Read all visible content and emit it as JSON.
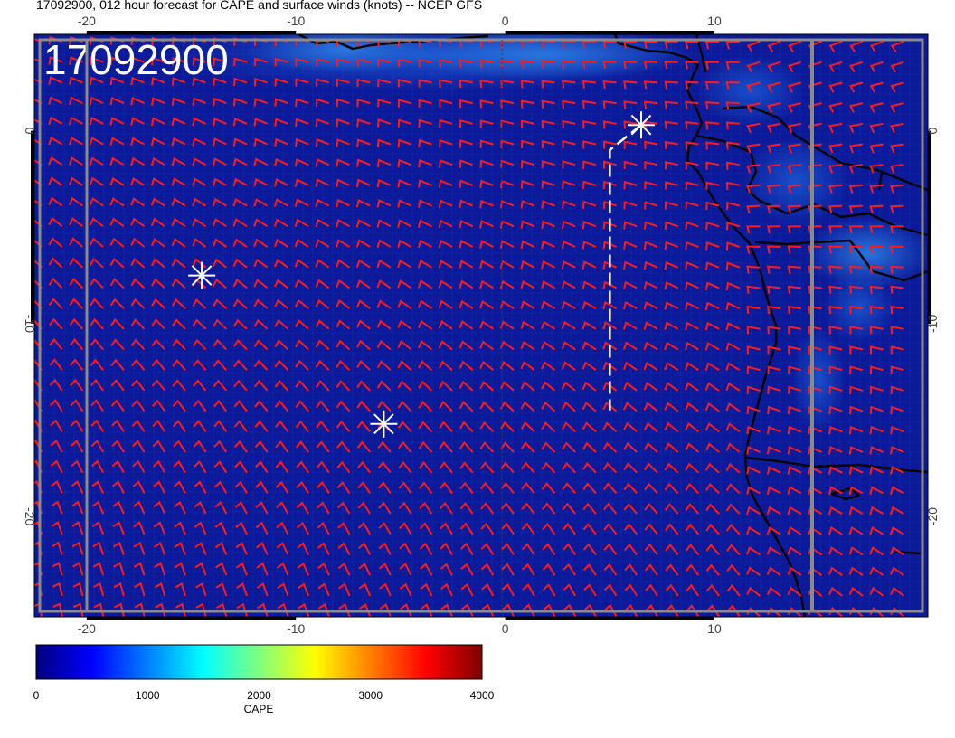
{
  "title": "17092900, 012 hour forecast for CAPE and surface winds (knots) -- NCEP GFS",
  "date_stamp": "17092900",
  "map": {
    "lon_ticks": [
      "-20",
      "-10",
      "0",
      "10"
    ],
    "lat_ticks": [
      "0",
      "-10",
      "-20"
    ],
    "lon_range": [
      -22.5,
      20.2
    ],
    "lat_range": [
      -25.2,
      5.0
    ],
    "colors": {
      "ocean": "#0a1a9a",
      "coast": "#000000",
      "wind_barbs": "#ff1a1a",
      "markers": "#ffffff",
      "frame": "#808080",
      "high_cape": "#2a7ae0"
    }
  },
  "markers": [
    {
      "name": "star-marker-1",
      "lon": -14.5,
      "lat": -7.5
    },
    {
      "name": "star-marker-2",
      "lon": -5.8,
      "lat": -15.2
    },
    {
      "name": "star-marker-3",
      "lon": 6.5,
      "lat": 0.3
    }
  ],
  "track": [
    {
      "lon": 6.5,
      "lat": 0.3
    },
    {
      "lon": 5.0,
      "lat": -1.0
    },
    {
      "lon": 5.0,
      "lat": -14.5
    }
  ],
  "colorbar": {
    "label": "CAPE",
    "ticks": [
      "0",
      "1000",
      "2000",
      "3000",
      "4000"
    ],
    "range": [
      0,
      4000
    ],
    "colors": [
      "#00007f",
      "#0000ff",
      "#007fff",
      "#00ffff",
      "#7fff7f",
      "#ffff00",
      "#ff7f00",
      "#ff0000",
      "#7f0000"
    ]
  }
}
